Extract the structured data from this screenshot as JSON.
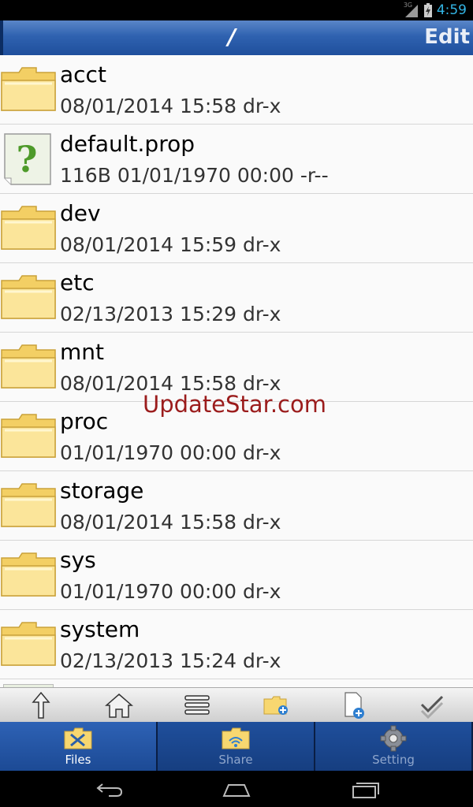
{
  "status_bar": {
    "network": "3G",
    "time": "4:59"
  },
  "header": {
    "path": "/",
    "edit_label": "Edit"
  },
  "files": [
    {
      "name": "acct",
      "meta": "08/01/2014 15:58 dr-x",
      "type": "folder"
    },
    {
      "name": "default.prop",
      "meta": "116B 01/01/1970 00:00 -r--",
      "type": "unknown-file"
    },
    {
      "name": "dev",
      "meta": "08/01/2014 15:59 dr-x",
      "type": "folder"
    },
    {
      "name": "etc",
      "meta": "02/13/2013 15:29 dr-x",
      "type": "folder"
    },
    {
      "name": "mnt",
      "meta": "08/01/2014 15:58 dr-x",
      "type": "folder"
    },
    {
      "name": "proc",
      "meta": "01/01/1970 00:00 dr-x",
      "type": "folder"
    },
    {
      "name": "storage",
      "meta": "08/01/2014 15:58 dr-x",
      "type": "folder"
    },
    {
      "name": "sys",
      "meta": "01/01/1970 00:00 dr-x",
      "type": "folder"
    },
    {
      "name": "system",
      "meta": "02/13/2013 15:24 dr-x",
      "type": "folder"
    }
  ],
  "watermark": "UpdateStar.com",
  "toolbar": [
    "up-arrow-icon",
    "home-icon",
    "list-view-icon",
    "new-folder-icon",
    "new-file-icon",
    "select-all-icon"
  ],
  "tabs": [
    {
      "label": "Files",
      "active": true
    },
    {
      "label": "Share",
      "active": false
    },
    {
      "label": "Setting",
      "active": false
    }
  ],
  "colors": {
    "accent": "#2f62b0",
    "time": "#33b5e5",
    "watermark": "#9b1c1c"
  }
}
